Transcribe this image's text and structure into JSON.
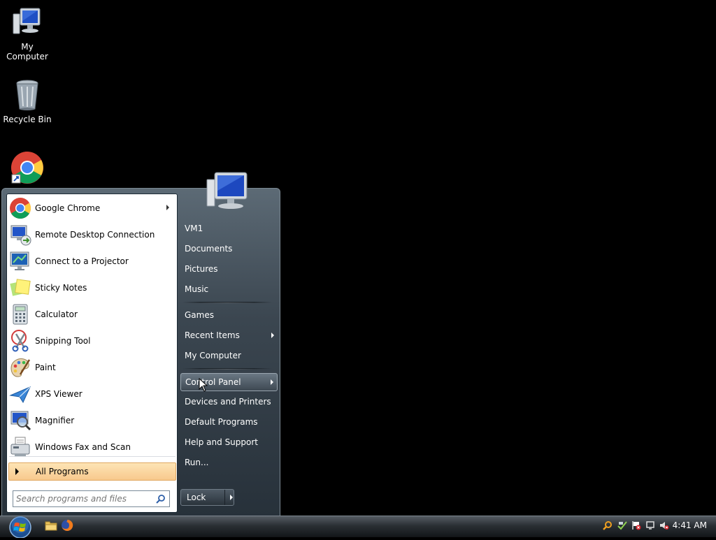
{
  "desktop": {
    "icons": [
      {
        "label": "My Computer",
        "icon": "computer-icon"
      },
      {
        "label": "Recycle Bin",
        "icon": "recycle-bin-icon"
      },
      {
        "label": "",
        "icon": "chrome-shortcut-icon"
      }
    ]
  },
  "start_menu": {
    "programs": [
      {
        "label": "Google Chrome",
        "icon": "chrome-icon",
        "has_submenu": true
      },
      {
        "label": "Remote Desktop Connection",
        "icon": "remote-desktop-icon"
      },
      {
        "label": "Connect to a Projector",
        "icon": "projector-icon"
      },
      {
        "label": "Sticky Notes",
        "icon": "sticky-notes-icon"
      },
      {
        "label": "Calculator",
        "icon": "calculator-icon"
      },
      {
        "label": "Snipping Tool",
        "icon": "snipping-tool-icon"
      },
      {
        "label": "Paint",
        "icon": "paint-icon"
      },
      {
        "label": "XPS Viewer",
        "icon": "xps-viewer-icon"
      },
      {
        "label": "Magnifier",
        "icon": "magnifier-icon"
      },
      {
        "label": "Windows Fax and Scan",
        "icon": "fax-scan-icon"
      }
    ],
    "all_programs": "All Programs",
    "search_placeholder": "Search programs and files",
    "right_items": [
      {
        "label": "VM1"
      },
      {
        "label": "Documents"
      },
      {
        "label": "Pictures"
      },
      {
        "label": "Music"
      },
      {
        "label": "Games"
      },
      {
        "label": "Recent Items",
        "has_submenu": true
      },
      {
        "label": "My Computer"
      },
      {
        "label": "Control Panel",
        "has_submenu": true,
        "highlighted": true
      },
      {
        "label": "Devices and Printers"
      },
      {
        "label": "Default Programs"
      },
      {
        "label": "Help and Support"
      },
      {
        "label": "Run..."
      }
    ],
    "lock_label": "Lock"
  },
  "taskbar": {
    "clock": "4:41 AM",
    "tray_icons": [
      "search-tray-icon",
      "network-tray-icon",
      "action-center-flag-icon",
      "display-tray-icon",
      "volume-muted-icon"
    ],
    "pinned": [
      "explorer-icon",
      "firefox-icon"
    ]
  },
  "colors": {
    "desktop_background": "#000000",
    "all_programs_highlight": "#f8c98d"
  }
}
